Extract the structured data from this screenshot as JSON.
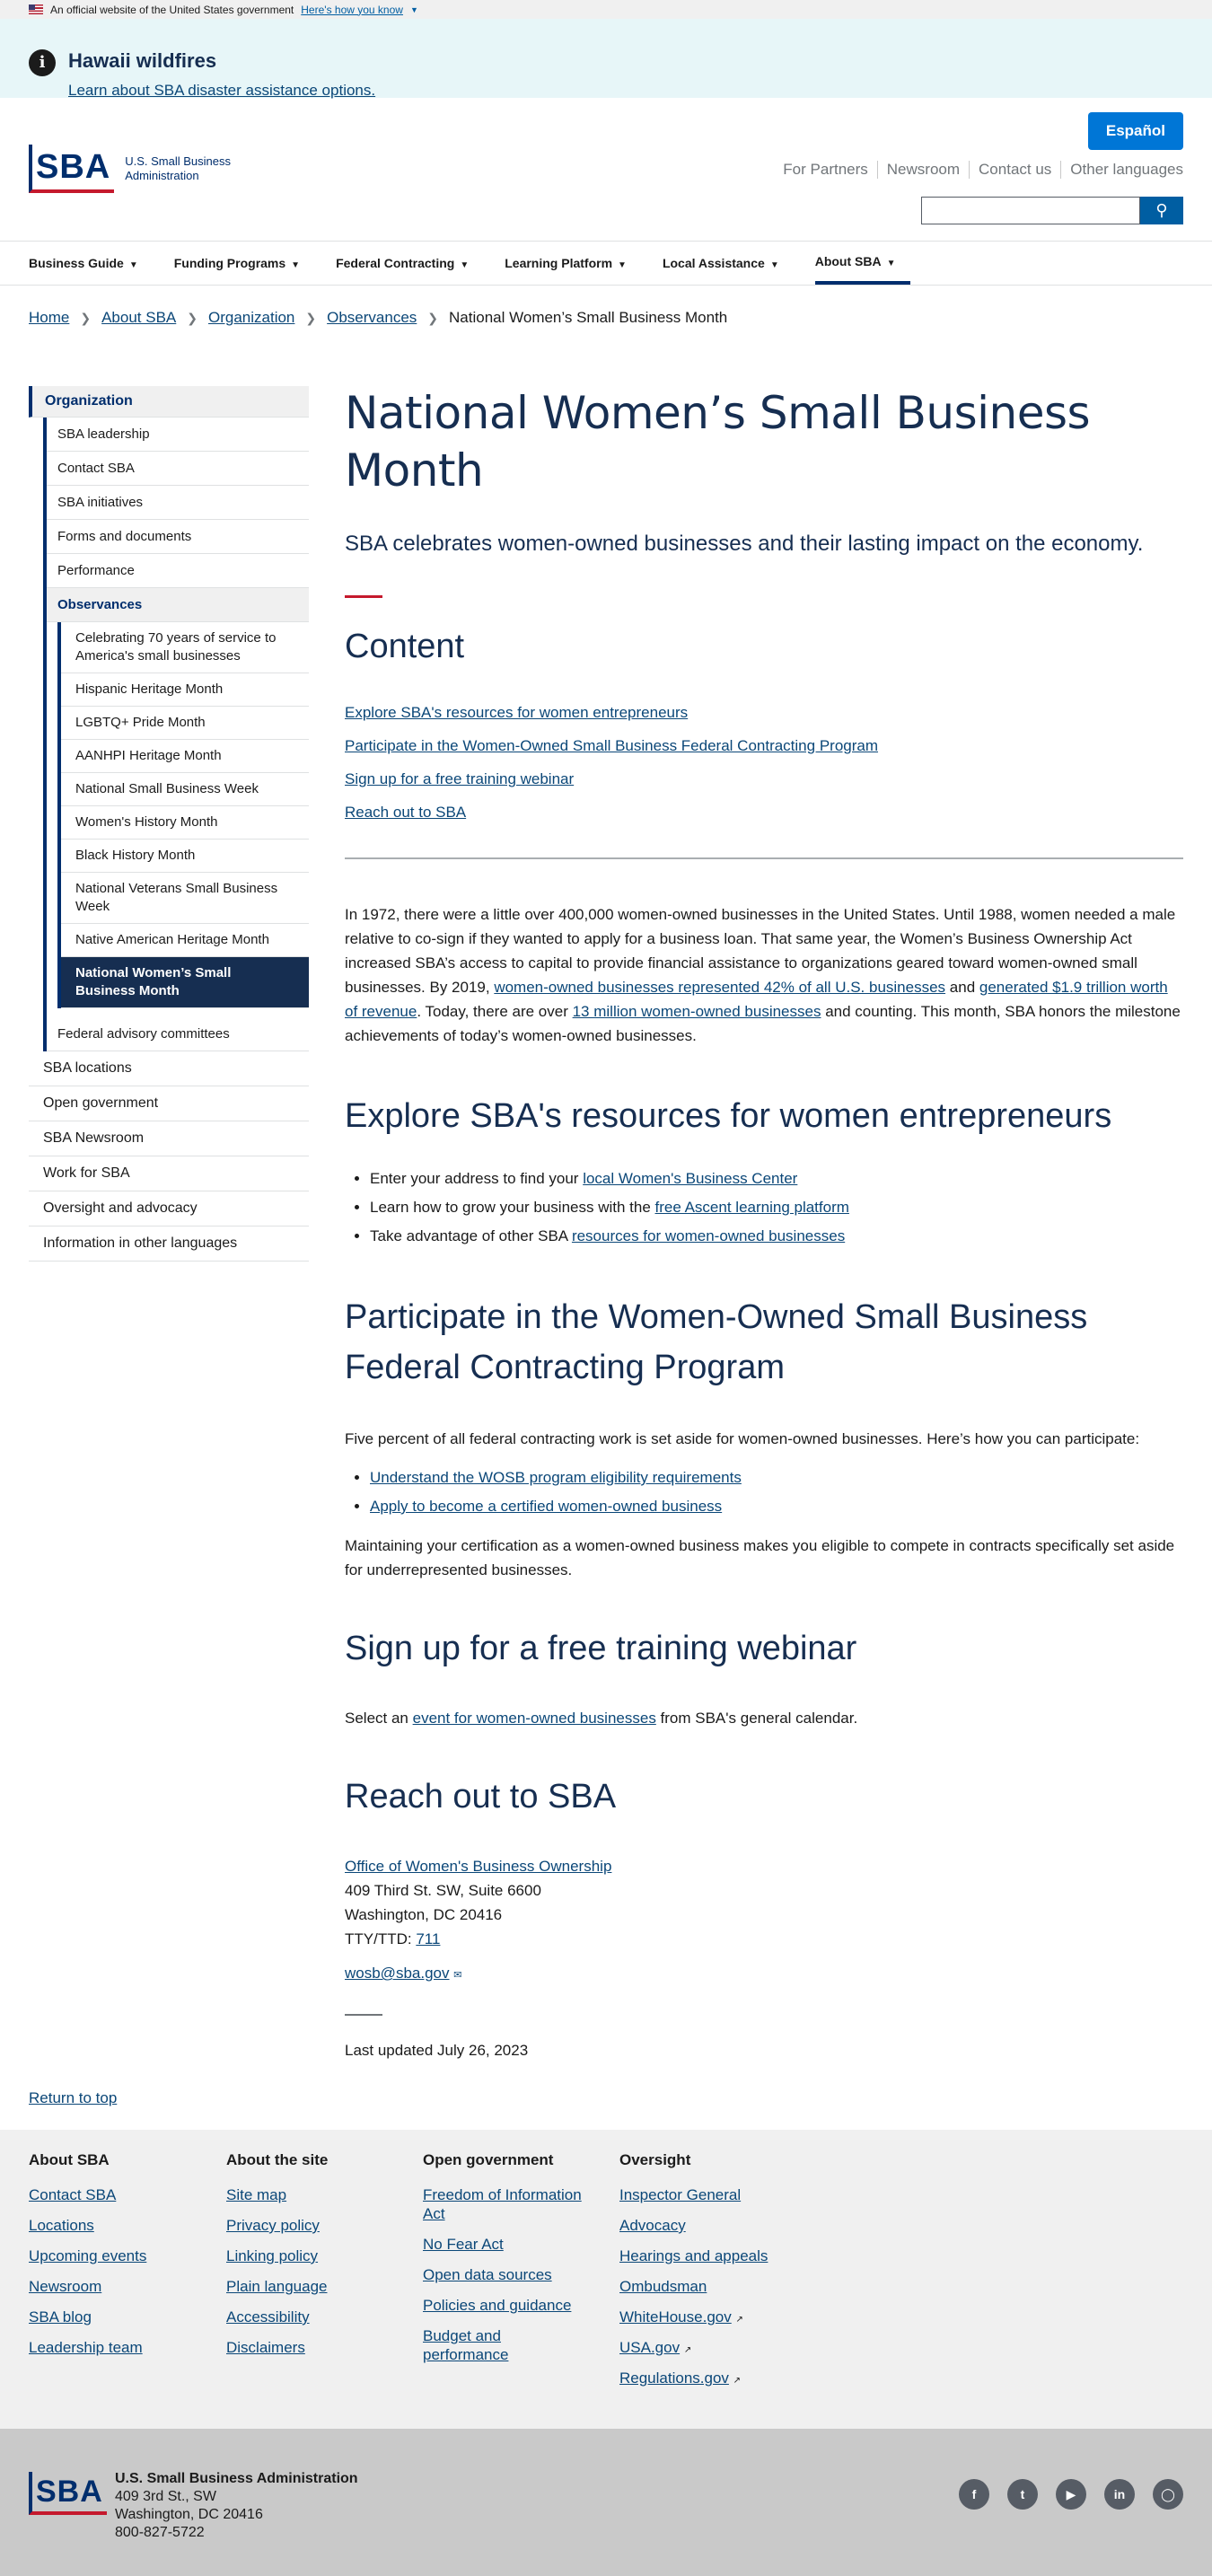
{
  "gov_banner": {
    "text": "An official website of the United States government",
    "link": "Here's how you know"
  },
  "alert": {
    "title": "Hawaii wildfires",
    "link": "Learn about SBA disaster assistance options."
  },
  "header": {
    "logo_mark": "SBA",
    "logo_line1": "U.S. Small Business",
    "logo_line2": "Administration",
    "espanol": "Español",
    "util_nav": [
      "For Partners",
      "Newsroom",
      "Contact us",
      "Other languages"
    ]
  },
  "main_nav": [
    "Business Guide",
    "Funding Programs",
    "Federal Contracting",
    "Learning Platform",
    "Local Assistance",
    "About SBA"
  ],
  "breadcrumb": [
    "Home",
    "About SBA",
    "Organization",
    "Observances",
    "National Women’s Small Business Month"
  ],
  "sidenav": {
    "top": "Organization",
    "level2": [
      "SBA leadership",
      "Contact SBA",
      "SBA initiatives",
      "Forms and documents",
      "Performance",
      "Observances"
    ],
    "level3": [
      "Celebrating 70 years of service to America's small businesses",
      "Hispanic Heritage Month",
      "LGBTQ+ Pride Month",
      "AANHPI Heritage Month",
      "National Small Business Week",
      "Women's History Month",
      "Black History Month",
      "National Veterans Small Business Week",
      "Native American Heritage Month",
      "National Women’s Small Business Month"
    ],
    "level2_after": "Federal advisory committees",
    "level1": [
      "SBA locations",
      "Open government",
      "SBA Newsroom",
      "Work for SBA",
      "Oversight and advocacy",
      "Information in other languages"
    ]
  },
  "main": {
    "title": "National Women’s Small Business Month",
    "lede": "SBA celebrates women-owned businesses and their lasting impact on the economy.",
    "contents_heading": "Content",
    "toc": [
      "Explore SBA's resources for women entrepreneurs",
      "Participate in the Women-Owned Small Business Federal Contracting Program",
      "Sign up for a free training webinar",
      "Reach out to SBA"
    ],
    "intro_1": "In 1972, there were a little over 400,000 women-owned businesses in the United States. Until 1988, women needed a male relative to co-sign if they wanted to apply for a business loan. That same year, the Women’s Business Ownership Act increased SBA’s access to capital to provide financial assistance to organizations geared toward women-owned small businesses. By 2019, ",
    "intro_link1": "women-owned businesses represented 42% of all U.S. businesses",
    "intro_2": " and ",
    "intro_link2": "generated $1.9 trillion worth of revenue",
    "intro_3": ". Today, there are over ",
    "intro_link3": "13 million women-owned businesses",
    "intro_4": " and counting. This month, SBA honors the milestone achievements of today’s women-owned businesses.",
    "s1_heading": "Explore SBA's resources for women entrepreneurs",
    "s1_items": [
      {
        "pre": "Enter your address to find your ",
        "link": "local Women's Business Center"
      },
      {
        "pre": "Learn how to grow your business with the ",
        "link": "free Ascent learning platform"
      },
      {
        "pre": "Take advantage of other SBA ",
        "link": "resources for women-owned businesses"
      }
    ],
    "s2_heading": "Participate in the Women-Owned Small Business Federal Contracting Program",
    "s2_p1": "Five percent of all federal contracting work is set aside for women-owned businesses. Here’s how you can participate:",
    "s2_links": [
      "Understand the WOSB program eligibility requirements",
      "Apply to become a certified women-owned business"
    ],
    "s2_p2": "Maintaining your certification as a women-owned business makes you eligible to compete in contracts specifically set aside for underrepresented businesses.",
    "s3_heading": "Sign up for a free training webinar",
    "s3_pre": "Select an ",
    "s3_link": "event for women-owned businesses",
    "s3_post": " from SBA's general calendar.",
    "s4_heading": "Reach out to SBA",
    "s4_office": "Office of Women's Business Ownership",
    "s4_addr1": "409 Third St. SW, Suite 6600",
    "s4_addr2": "Washington, DC 20416",
    "s4_tty_label": "TTY/TTD: ",
    "s4_tty": "711",
    "s4_email": "wosb@sba.gov",
    "updated": "Last updated July 26, 2023"
  },
  "return_top": "Return to top",
  "footer": {
    "cols": [
      {
        "title": "About SBA",
        "links": [
          "Contact SBA",
          "Locations",
          "Upcoming events",
          "Newsroom",
          "SBA blog",
          "Leadership team"
        ]
      },
      {
        "title": "About the site",
        "links": [
          "Site map",
          "Privacy policy",
          "Linking policy",
          "Plain language",
          "Accessibility",
          "Disclaimers"
        ]
      },
      {
        "title": "Open government",
        "links": [
          "Freedom of Information Act",
          "No Fear Act",
          "Open data sources",
          "Policies and guidance",
          "Budget and performance"
        ]
      },
      {
        "title": "Oversight",
        "links": [
          "Inspector General",
          "Advocacy",
          "Hearings and appeals",
          "Ombudsman",
          "WhiteHouse.gov",
          "USA.gov",
          "Regulations.gov"
        ]
      }
    ],
    "org_name": "U.S. Small Business Administration",
    "org_addr1": "409 3rd St., SW",
    "org_addr2": "Washington, DC 20416",
    "org_phone": "800-827-5722",
    "social": [
      "facebook-icon",
      "twitter-icon",
      "youtube-icon",
      "linkedin-icon",
      "instagram-icon"
    ]
  }
}
